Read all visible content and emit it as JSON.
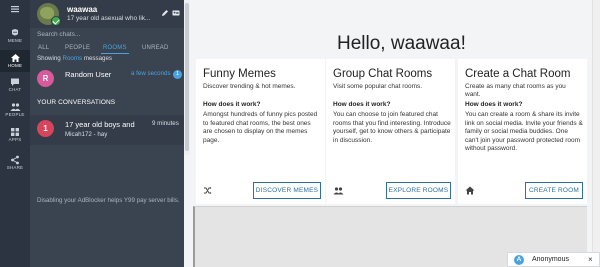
{
  "rail": {
    "items": [
      {
        "label": "",
        "icon": "menu-icon"
      },
      {
        "label": "MEME",
        "icon": "meme-icon"
      },
      {
        "label": "HOME",
        "icon": "home-icon"
      },
      {
        "label": "CHAT",
        "icon": "chat-icon"
      },
      {
        "label": "PEOPLE",
        "icon": "people-icon"
      },
      {
        "label": "APPS",
        "icon": "apps-icon"
      },
      {
        "label": "SHARE",
        "icon": "share-icon"
      }
    ],
    "active": "HOME"
  },
  "profile": {
    "name": "waawaa",
    "bio": "17 year old asexual who lik..."
  },
  "search": {
    "placeholder": "Search chats..."
  },
  "tabs": [
    "ALL",
    "PEOPLE",
    "ROOMS",
    "UNREAD"
  ],
  "active_tab": "ROOMS",
  "showing": {
    "prefix": "Showing",
    "highlight": "Rooms",
    "suffix": "messages"
  },
  "conversations_top": {
    "title": "Random User",
    "time": "a few seconds",
    "unread": "1",
    "avatar_letter": "R",
    "avatar_color": "#d75a9a"
  },
  "section_title": "YOUR CONVERSATIONS",
  "conversations": [
    {
      "avatar_letter": "1",
      "avatar_color": "#d6455c",
      "title": "17 year old boys and",
      "subtitle": "Micah172 - hay",
      "time": "9 minutes"
    }
  ],
  "adblock_notice": "Disabling your AdBlocker helps Y99 pay server bills.",
  "main": {
    "greeting": "Hello, waawaa!",
    "cards": [
      {
        "title": "Funny Memes",
        "subtitle": "Discover trending & hot memes.",
        "how": "How does it work?",
        "body": "Amongst hundreds of funny pics posted to featured chat rooms, the best ones are chosen to display on the memes page.",
        "button": "DISCOVER MEMES",
        "icon": "shuffle-icon"
      },
      {
        "title": "Group Chat Rooms",
        "subtitle": "Visit some popular chat rooms.",
        "how": "How does it work?",
        "body": "You can choose to join featured chat rooms that you find interesting. Introduce yourself, get to know others & participate in discussion.",
        "button": "EXPLORE ROOMS",
        "icon": "group-icon"
      },
      {
        "title": "Create a Chat Room",
        "subtitle": "Create as many chat rooms as you want.",
        "how": "How does it work?",
        "body": "You can create a room & share its invite link on social media. Invite your friends & family or social media buddies. One can't join your password protected room without password.",
        "button": "CREATE ROOM",
        "icon": "home-icon"
      }
    ]
  },
  "anon": {
    "letter": "A",
    "name": "Anonymous",
    "close": "×"
  },
  "colors": {
    "accent": "#4aa3df",
    "button": "#2e6f9e",
    "rail": "#2b3440",
    "panel": "#3a4350"
  }
}
